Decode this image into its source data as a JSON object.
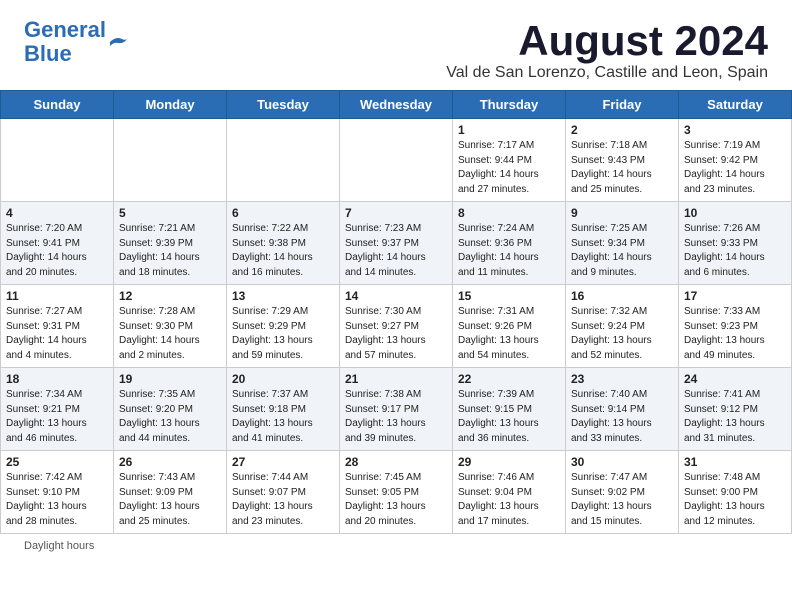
{
  "header": {
    "logo_line1": "General",
    "logo_line2": "Blue",
    "month_title": "August 2024",
    "location": "Val de San Lorenzo, Castille and Leon, Spain"
  },
  "days_of_week": [
    "Sunday",
    "Monday",
    "Tuesday",
    "Wednesday",
    "Thursday",
    "Friday",
    "Saturday"
  ],
  "weeks": [
    [
      {
        "day": "",
        "info": ""
      },
      {
        "day": "",
        "info": ""
      },
      {
        "day": "",
        "info": ""
      },
      {
        "day": "",
        "info": ""
      },
      {
        "day": "1",
        "info": "Sunrise: 7:17 AM\nSunset: 9:44 PM\nDaylight: 14 hours\nand 27 minutes."
      },
      {
        "day": "2",
        "info": "Sunrise: 7:18 AM\nSunset: 9:43 PM\nDaylight: 14 hours\nand 25 minutes."
      },
      {
        "day": "3",
        "info": "Sunrise: 7:19 AM\nSunset: 9:42 PM\nDaylight: 14 hours\nand 23 minutes."
      }
    ],
    [
      {
        "day": "4",
        "info": "Sunrise: 7:20 AM\nSunset: 9:41 PM\nDaylight: 14 hours\nand 20 minutes."
      },
      {
        "day": "5",
        "info": "Sunrise: 7:21 AM\nSunset: 9:39 PM\nDaylight: 14 hours\nand 18 minutes."
      },
      {
        "day": "6",
        "info": "Sunrise: 7:22 AM\nSunset: 9:38 PM\nDaylight: 14 hours\nand 16 minutes."
      },
      {
        "day": "7",
        "info": "Sunrise: 7:23 AM\nSunset: 9:37 PM\nDaylight: 14 hours\nand 14 minutes."
      },
      {
        "day": "8",
        "info": "Sunrise: 7:24 AM\nSunset: 9:36 PM\nDaylight: 14 hours\nand 11 minutes."
      },
      {
        "day": "9",
        "info": "Sunrise: 7:25 AM\nSunset: 9:34 PM\nDaylight: 14 hours\nand 9 minutes."
      },
      {
        "day": "10",
        "info": "Sunrise: 7:26 AM\nSunset: 9:33 PM\nDaylight: 14 hours\nand 6 minutes."
      }
    ],
    [
      {
        "day": "11",
        "info": "Sunrise: 7:27 AM\nSunset: 9:31 PM\nDaylight: 14 hours\nand 4 minutes."
      },
      {
        "day": "12",
        "info": "Sunrise: 7:28 AM\nSunset: 9:30 PM\nDaylight: 14 hours\nand 2 minutes."
      },
      {
        "day": "13",
        "info": "Sunrise: 7:29 AM\nSunset: 9:29 PM\nDaylight: 13 hours\nand 59 minutes."
      },
      {
        "day": "14",
        "info": "Sunrise: 7:30 AM\nSunset: 9:27 PM\nDaylight: 13 hours\nand 57 minutes."
      },
      {
        "day": "15",
        "info": "Sunrise: 7:31 AM\nSunset: 9:26 PM\nDaylight: 13 hours\nand 54 minutes."
      },
      {
        "day": "16",
        "info": "Sunrise: 7:32 AM\nSunset: 9:24 PM\nDaylight: 13 hours\nand 52 minutes."
      },
      {
        "day": "17",
        "info": "Sunrise: 7:33 AM\nSunset: 9:23 PM\nDaylight: 13 hours\nand 49 minutes."
      }
    ],
    [
      {
        "day": "18",
        "info": "Sunrise: 7:34 AM\nSunset: 9:21 PM\nDaylight: 13 hours\nand 46 minutes."
      },
      {
        "day": "19",
        "info": "Sunrise: 7:35 AM\nSunset: 9:20 PM\nDaylight: 13 hours\nand 44 minutes."
      },
      {
        "day": "20",
        "info": "Sunrise: 7:37 AM\nSunset: 9:18 PM\nDaylight: 13 hours\nand 41 minutes."
      },
      {
        "day": "21",
        "info": "Sunrise: 7:38 AM\nSunset: 9:17 PM\nDaylight: 13 hours\nand 39 minutes."
      },
      {
        "day": "22",
        "info": "Sunrise: 7:39 AM\nSunset: 9:15 PM\nDaylight: 13 hours\nand 36 minutes."
      },
      {
        "day": "23",
        "info": "Sunrise: 7:40 AM\nSunset: 9:14 PM\nDaylight: 13 hours\nand 33 minutes."
      },
      {
        "day": "24",
        "info": "Sunrise: 7:41 AM\nSunset: 9:12 PM\nDaylight: 13 hours\nand 31 minutes."
      }
    ],
    [
      {
        "day": "25",
        "info": "Sunrise: 7:42 AM\nSunset: 9:10 PM\nDaylight: 13 hours\nand 28 minutes."
      },
      {
        "day": "26",
        "info": "Sunrise: 7:43 AM\nSunset: 9:09 PM\nDaylight: 13 hours\nand 25 minutes."
      },
      {
        "day": "27",
        "info": "Sunrise: 7:44 AM\nSunset: 9:07 PM\nDaylight: 13 hours\nand 23 minutes."
      },
      {
        "day": "28",
        "info": "Sunrise: 7:45 AM\nSunset: 9:05 PM\nDaylight: 13 hours\nand 20 minutes."
      },
      {
        "day": "29",
        "info": "Sunrise: 7:46 AM\nSunset: 9:04 PM\nDaylight: 13 hours\nand 17 minutes."
      },
      {
        "day": "30",
        "info": "Sunrise: 7:47 AM\nSunset: 9:02 PM\nDaylight: 13 hours\nand 15 minutes."
      },
      {
        "day": "31",
        "info": "Sunrise: 7:48 AM\nSunset: 9:00 PM\nDaylight: 13 hours\nand 12 minutes."
      }
    ]
  ],
  "footer": {
    "daylight_label": "Daylight hours"
  }
}
